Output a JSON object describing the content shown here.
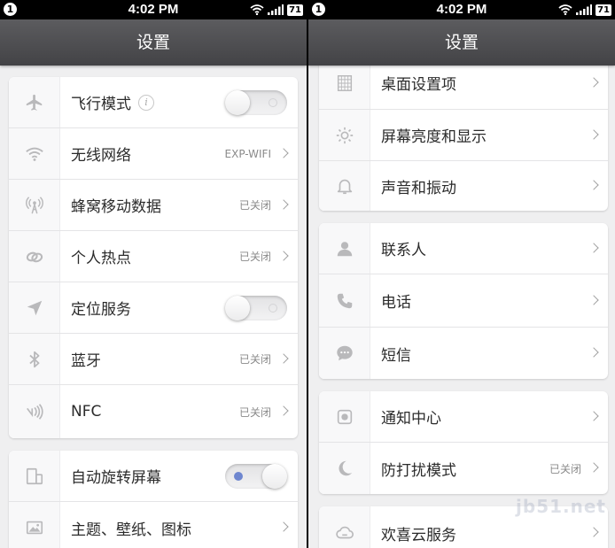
{
  "status_bar": {
    "time": "4:02 PM",
    "notification": "1",
    "battery": "71"
  },
  "left": {
    "title": "设置",
    "group1": [
      {
        "label": "飞行模式",
        "type": "toggle",
        "state": "off",
        "icon": "airplane-icon"
      },
      {
        "label": "无线网络",
        "value": "EXP-WIFI",
        "icon": "wifi-icon"
      },
      {
        "label": "蜂窝移动数据",
        "value": "已关闭",
        "icon": "cellular-tower-icon"
      },
      {
        "label": "个人热点",
        "value": "已关闭",
        "icon": "hotspot-icon"
      },
      {
        "label": "定位服务",
        "type": "toggle",
        "state": "off",
        "icon": "location-arrow-icon"
      },
      {
        "label": "蓝牙",
        "value": "已关闭",
        "icon": "bluetooth-icon"
      },
      {
        "label": "NFC",
        "value": "已关闭",
        "icon": "nfc-icon"
      }
    ],
    "group2": [
      {
        "label": "自动旋转屏幕",
        "type": "toggle",
        "state": "on",
        "icon": "rotate-screen-icon"
      },
      {
        "label": "主题、壁纸、图标",
        "icon": "image-icon"
      }
    ]
  },
  "right": {
    "title": "设置",
    "group1": [
      {
        "label": "桌面设置项",
        "icon": "grid-icon"
      },
      {
        "label": "屏幕亮度和显示",
        "icon": "brightness-icon"
      },
      {
        "label": "声音和振动",
        "icon": "bell-icon"
      }
    ],
    "group2": [
      {
        "label": "联系人",
        "icon": "person-icon"
      },
      {
        "label": "电话",
        "icon": "phone-icon"
      },
      {
        "label": "短信",
        "icon": "message-icon"
      }
    ],
    "group3": [
      {
        "label": "通知中心",
        "icon": "notification-icon"
      },
      {
        "label": "防打扰模式",
        "value": "已关闭",
        "icon": "moon-icon"
      }
    ],
    "group4": [
      {
        "label": "欢喜云服务",
        "icon": "cloud-icon"
      }
    ]
  },
  "watermark": "jb51.net",
  "colors": {
    "title_bar": "#4f4f52",
    "background": "#efeff0",
    "toggle_on_dot": "#6e86cf",
    "icon": "#b9b9bb"
  }
}
